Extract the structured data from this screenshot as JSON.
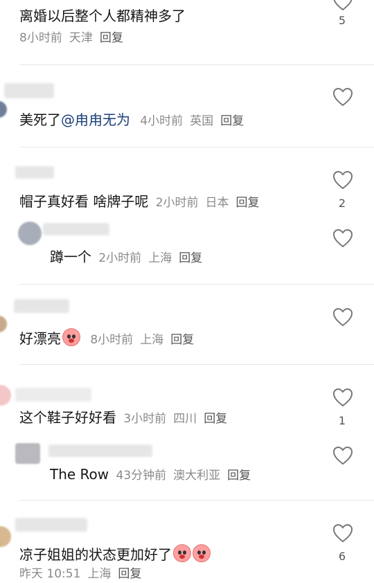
{
  "comments": [
    {
      "text": "离婚以后整个人都精神多了",
      "time": "8小时前",
      "location": "天津",
      "reply": "回复",
      "likes": "5"
    },
    {
      "text": "美死了",
      "mention": "@甪甪无为",
      "time": "4小时前",
      "location": "英国",
      "reply": "回复",
      "likes": ""
    },
    {
      "text": "帽子真好看 啥牌子呢",
      "time": "2小时前",
      "location": "日本",
      "reply": "回复",
      "likes": "2"
    },
    {
      "text": "蹲一个",
      "time": "2小时前",
      "location": "上海",
      "reply": "回复",
      "likes": ""
    },
    {
      "text": "好漂亮",
      "time": "8小时前",
      "location": "上海",
      "reply": "回复",
      "likes": ""
    },
    {
      "text": "这个鞋子好好看",
      "time": "3小时前",
      "location": "四川",
      "reply": "回复",
      "likes": "1"
    },
    {
      "text": "The Row",
      "time": "43分钟前",
      "location": "澳大利亚",
      "reply": "回复",
      "likes": ""
    },
    {
      "text": "凉子姐姐的状态更加好了",
      "time": "昨天 10:51",
      "location": "上海",
      "reply": "回复",
      "likes": "6"
    }
  ],
  "icons": {
    "like": "heart-outline-icon",
    "emoji": "pig-face-emoji-icon"
  }
}
